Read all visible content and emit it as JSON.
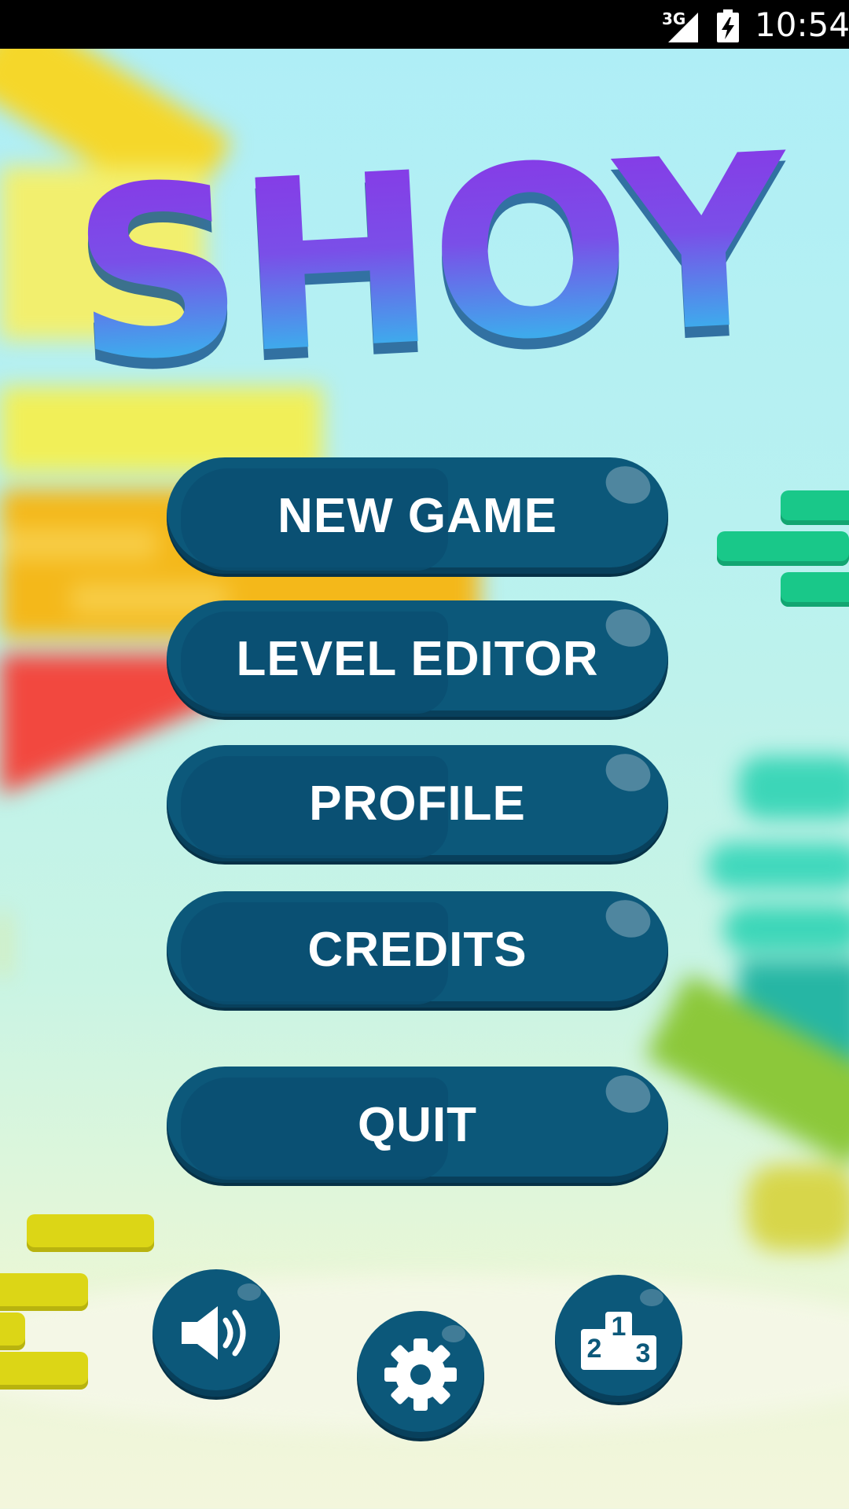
{
  "status_bar": {
    "network": "3G",
    "time": "10:54",
    "signal_icon": "signal-icon",
    "battery_icon": "battery-charging-icon"
  },
  "logo": {
    "text": "SHOY"
  },
  "menu": {
    "new_game": "NEW GAME",
    "level_editor": "LEVEL EDITOR",
    "profile": "PROFILE",
    "credits": "CREDITS",
    "quit": "QUIT"
  },
  "round_buttons": {
    "sound_icon": "speaker-icon",
    "settings_icon": "gear-icon",
    "leaderboard_icon": "podium-icon",
    "podium_digits": [
      "2",
      "1",
      "3"
    ]
  },
  "colors": {
    "button": "#0c587a",
    "logo_top": "#8a34e6",
    "logo_bottom": "#27c3ee"
  }
}
